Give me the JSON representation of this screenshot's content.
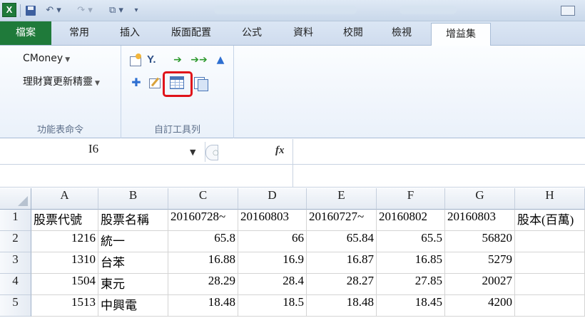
{
  "app": {
    "logo_letter": "X"
  },
  "quick_access": {
    "icons": [
      "save-icon",
      "undo-icon",
      "redo-icon",
      "window-icon",
      "customize-icon"
    ]
  },
  "tabs": [
    {
      "label": "檔案"
    },
    {
      "label": "常用"
    },
    {
      "label": "插入"
    },
    {
      "label": "版面配置"
    },
    {
      "label": "公式"
    },
    {
      "label": "資料"
    },
    {
      "label": "校閱"
    },
    {
      "label": "檢視"
    },
    {
      "label": "增益集"
    }
  ],
  "active_tab": "增益集",
  "ribbon": {
    "menu_commands_group": {
      "label": "功能表命令",
      "items": [
        {
          "label": "CMoney"
        },
        {
          "label": "理財寶更新精靈"
        }
      ]
    },
    "custom_toolbar_group": {
      "label": "自訂工具列",
      "highlighted_icon": "table-icon"
    }
  },
  "formula_bar": {
    "name_box": "I6",
    "fx_label": "fx",
    "formula": ""
  },
  "sheet": {
    "columns": [
      "A",
      "B",
      "C",
      "D",
      "E",
      "F",
      "G",
      "H"
    ],
    "rows": [
      {
        "num": "1",
        "cells": [
          "股票代號",
          "股票名稱",
          "20160728~",
          "20160803",
          "20160727~",
          "20160802",
          "20160803",
          "股本(百萬)"
        ]
      },
      {
        "num": "2",
        "cells": [
          "1216",
          "統一",
          "65.8",
          "66",
          "65.84",
          "65.5",
          "56820",
          ""
        ]
      },
      {
        "num": "3",
        "cells": [
          "1310",
          "台苯",
          "16.88",
          "16.9",
          "16.87",
          "16.85",
          "5279",
          ""
        ]
      },
      {
        "num": "4",
        "cells": [
          "1504",
          "東元",
          "28.29",
          "28.4",
          "28.27",
          "27.85",
          "20027",
          ""
        ]
      },
      {
        "num": "5",
        "cells": [
          "1513",
          "中興電",
          "18.48",
          "18.5",
          "18.48",
          "18.45",
          "4200",
          ""
        ]
      }
    ]
  },
  "colors": {
    "file_tab": "#1f7a3a",
    "highlight_box": "#e0131a",
    "ribbon_bg": "#eaf1fa"
  }
}
